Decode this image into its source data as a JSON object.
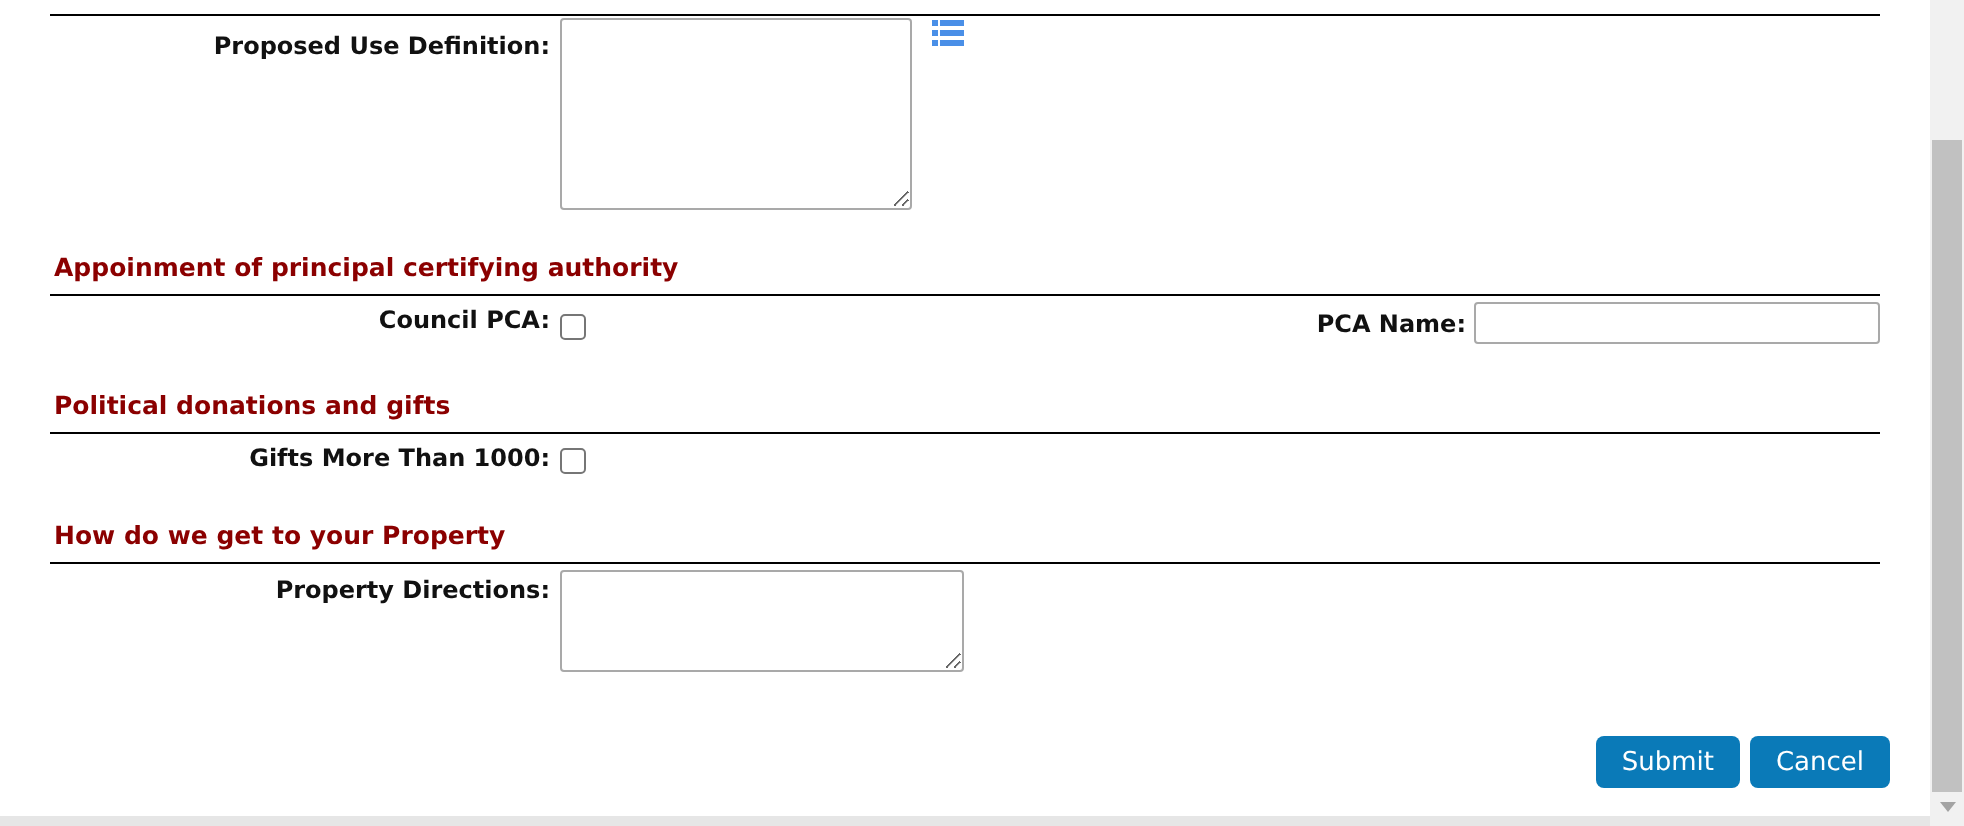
{
  "top_field": {
    "label": "Proposed Use Definition:",
    "kind": "textarea"
  },
  "sections": [
    {
      "heading": "Appoinment of principal certifying authority",
      "fields": [
        {
          "label": "Council PCA:",
          "kind": "checkbox",
          "checked": false
        },
        {
          "label": "PCA Name:",
          "kind": "text"
        }
      ]
    },
    {
      "heading": "Political donations and gifts",
      "fields": [
        {
          "label": "Gifts More Than 1000:",
          "kind": "checkbox",
          "checked": false
        }
      ]
    },
    {
      "heading": "How do we get to your Property",
      "fields": [
        {
          "label": "Property Directions:",
          "kind": "textarea"
        }
      ]
    }
  ],
  "buttons": [
    "Submit",
    "Cancel"
  ]
}
